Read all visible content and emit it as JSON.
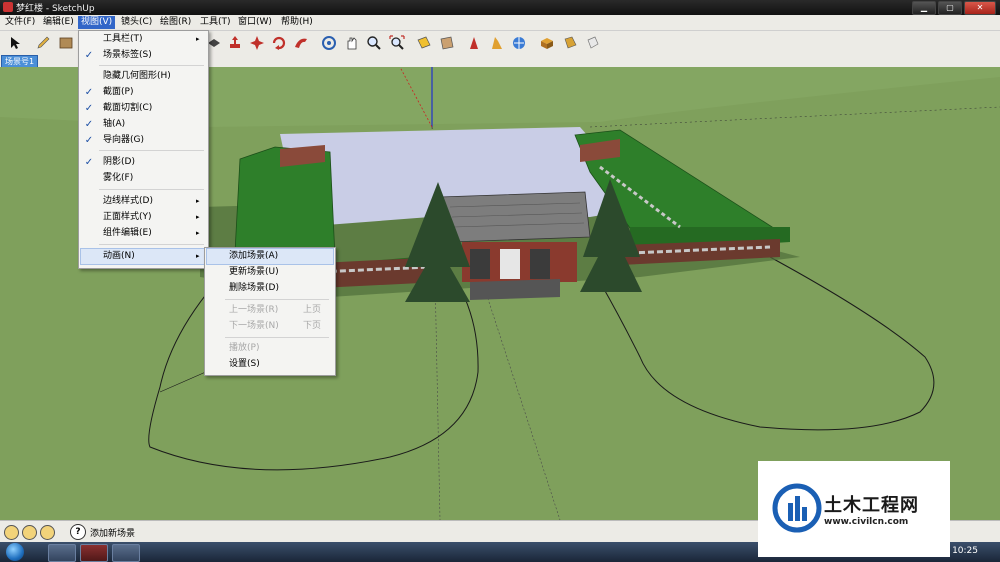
{
  "window": {
    "title": "梦红楼 - SketchUp"
  },
  "menubar": {
    "items": [
      {
        "label": "文件(F)"
      },
      {
        "label": "编辑(E)"
      },
      {
        "label": "视图(V)"
      },
      {
        "label": "镜头(C)"
      },
      {
        "label": "绘图(R)"
      },
      {
        "label": "工具(T)"
      },
      {
        "label": "窗口(W)"
      },
      {
        "label": "帮助(H)"
      }
    ],
    "active": "视图(V)"
  },
  "scene_tabs": [
    {
      "label": "场景号1"
    }
  ],
  "view_menu": {
    "items": [
      {
        "label": "工具栏(T)",
        "checked": false,
        "submenu": true
      },
      {
        "label": "场景标签(S)",
        "checked": true,
        "submenu": false
      },
      {
        "label": "隐藏几何图形(H)",
        "checked": false,
        "submenu": false
      },
      {
        "label": "截面(P)",
        "checked": true,
        "submenu": false
      },
      {
        "label": "截面切割(C)",
        "checked": true,
        "submenu": false
      },
      {
        "label": "轴(A)",
        "checked": true,
        "submenu": false
      },
      {
        "label": "导向器(G)",
        "checked": true,
        "submenu": false
      },
      {
        "label": "阴影(D)",
        "checked": true,
        "submenu": false
      },
      {
        "label": "雾化(F)",
        "checked": false,
        "submenu": false
      },
      {
        "label": "边线样式(D)",
        "checked": false,
        "submenu": true
      },
      {
        "label": "正面样式(Y)",
        "checked": false,
        "submenu": true
      },
      {
        "label": "组件编辑(E)",
        "checked": false,
        "submenu": true
      },
      {
        "label": "动画(N)",
        "checked": false,
        "submenu": true
      }
    ],
    "check_glyph": "✓",
    "arrow_glyph": "▸"
  },
  "animation_menu": {
    "items": [
      {
        "label": "添加场景(A)",
        "shortcut": "",
        "disabled": false
      },
      {
        "label": "更新场景(U)",
        "shortcut": "",
        "disabled": false
      },
      {
        "label": "删除场景(D)",
        "shortcut": "",
        "disabled": false
      },
      {
        "label": "上一场景(R)",
        "shortcut": "上页",
        "disabled": true
      },
      {
        "label": "下一场景(N)",
        "shortcut": "下页",
        "disabled": true
      },
      {
        "label": "播放(P)",
        "shortcut": "",
        "disabled": true
      },
      {
        "label": "设置(S)",
        "shortcut": "",
        "disabled": false
      }
    ],
    "highlighted": "添加场景(A)"
  },
  "toolbar": {
    "icons": [
      "select-icon",
      "pencil-icon",
      "eraser-icon",
      "push-pull-icon",
      "move-icon",
      "rotate-icon",
      "follow-me-icon",
      "orbit-icon",
      "pan-icon",
      "zoom-icon",
      "zoom-extents-icon",
      "section-plane-icon",
      "walk-icon",
      "position-camera-icon",
      "look-around-icon",
      "components-icon",
      "photo-textures-icon",
      "share-model-icon"
    ]
  },
  "statusbar": {
    "text": "添加新场景",
    "help_glyph": "?",
    "icons": [
      "geo-location-icon",
      "credits-icon",
      "user-icon"
    ]
  },
  "taskbar": {
    "clock": "10:25"
  },
  "watermark": {
    "title": "土木工程网",
    "url": "www.civilcn.com"
  },
  "colors": {
    "grass": "#7fa05c",
    "roof_green": "#2e7f2a",
    "courtyard": "#c9cde6",
    "menu_highlight": "#3266c8"
  }
}
